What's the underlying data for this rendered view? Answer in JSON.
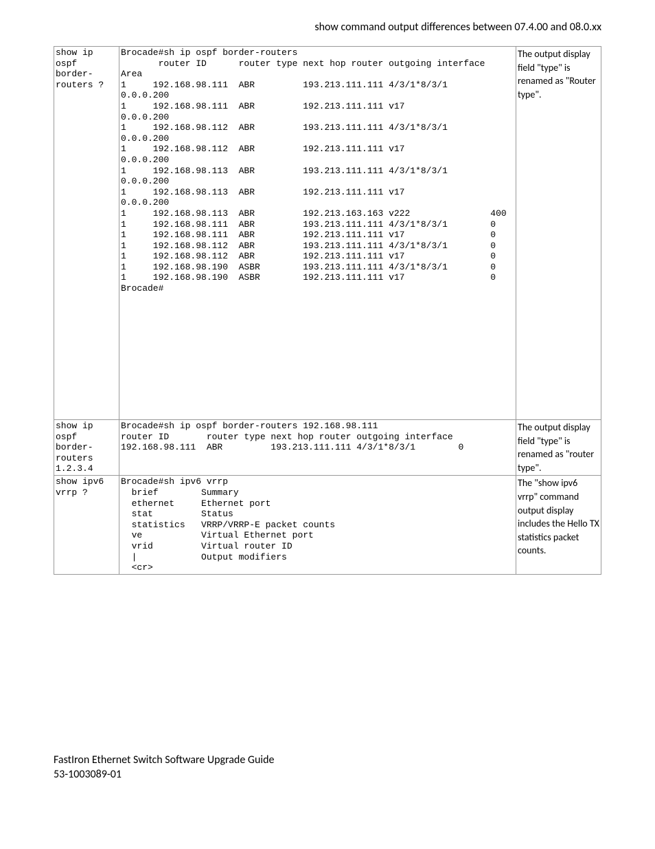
{
  "header": {
    "title": "show command output differences between 07.4.00 and 08.0.xx"
  },
  "rows": [
    {
      "command": "show ip\nospf\nborder-\nrouters ?",
      "output": "Brocade#sh ip ospf border-routers\n       router ID      router type next hop router outgoing interface\nArea\n1     192.168.98.111  ABR         193.213.111.111 4/3/1*8/3/1\n0.0.0.200\n1     192.168.98.111  ABR         192.213.111.111 v17\n0.0.0.200\n1     192.168.98.112  ABR         193.213.111.111 4/3/1*8/3/1\n0.0.0.200\n1     192.168.98.112  ABR         192.213.111.111 v17\n0.0.0.200\n1     192.168.98.113  ABR         193.213.111.111 4/3/1*8/3/1\n0.0.0.200\n1     192.168.98.113  ABR         192.213.111.111 v17\n0.0.0.200\n1     192.168.98.113  ABR         192.213.163.163 v222               400\n1     192.168.98.111  ABR         193.213.111.111 4/3/1*8/3/1        0\n1     192.168.98.111  ABR         192.213.111.111 v17                0\n1     192.168.98.112  ABR         193.213.111.111 4/3/1*8/3/1        0\n1     192.168.98.112  ABR         192.213.111.111 v17                0\n1     192.168.98.190  ASBR        193.213.111.111 4/3/1*8/3/1        0\n1     192.168.98.190  ASBR        192.213.111.111 v17                0\nBrocade#",
      "notes": "The output display field \"type\" is renamed as \"Router type\"."
    },
    {
      "command": "show ip\nospf\nborder-\nrouters\n1.2.3.4",
      "output": "Brocade#sh ip ospf border-routers 192.168.98.111\nrouter ID       router type next hop router outgoing interface\n192.168.98.111  ABR         193.213.111.111 4/3/1*8/3/1        0",
      "notes": "The output display field \"type\" is renamed as \"router type\"."
    },
    {
      "command": "show ipv6\nvrrp ?",
      "output": "Brocade#sh ipv6 vrrp\n  brief        Summary\n  ethernet     Ethernet port\n  stat         Status\n  statistics   VRRP/VRRP-E packet counts\n  ve           Virtual Ethernet port\n  vrid         Virtual router ID\n  |            Output modifiers\n  <cr>",
      "notes": "The \"show ipv6 vrrp\" command output display includes the  Hello TX statistics packet counts."
    }
  ],
  "footer": {
    "line1": "FastIron Ethernet Switch Software Upgrade Guide",
    "line2": "53-1003089-01"
  }
}
